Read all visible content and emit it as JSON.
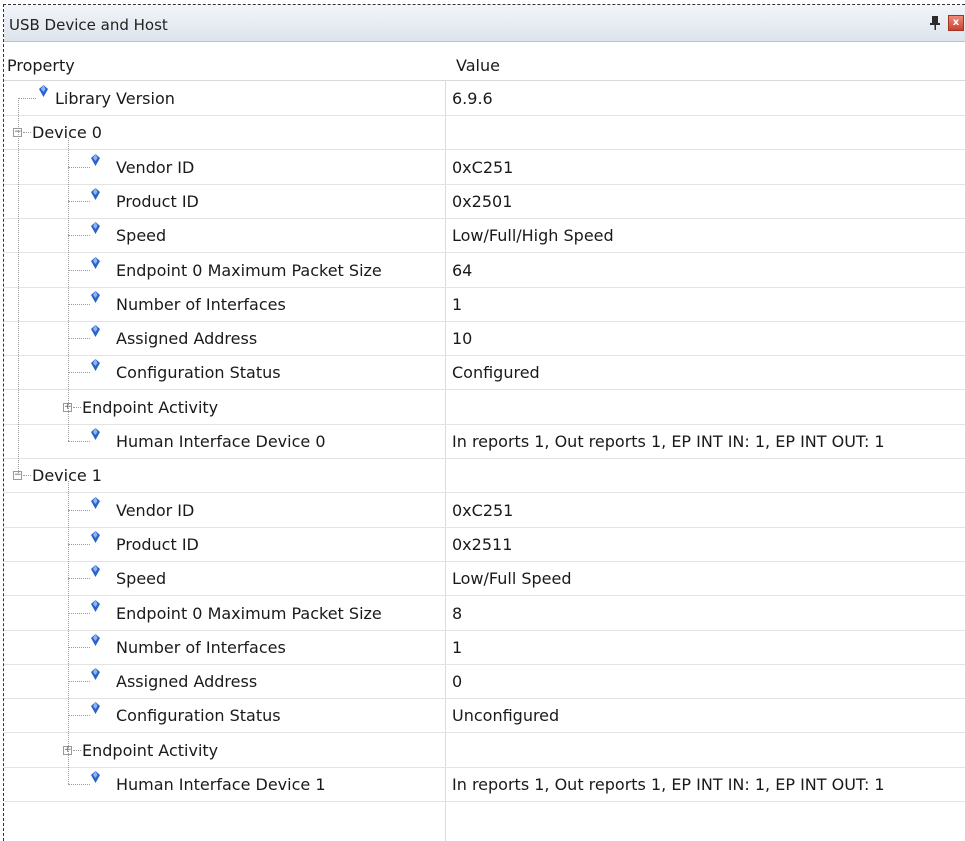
{
  "panel": {
    "title": "USB Device and Host",
    "close_label": "x"
  },
  "columns": {
    "property": "Property",
    "value": "Value"
  },
  "rows": [
    {
      "name": "Library Version",
      "value": "6.9.6"
    },
    {
      "name": "Device 0",
      "value": ""
    },
    {
      "name": "Vendor ID",
      "value": "0xC251"
    },
    {
      "name": "Product ID",
      "value": "0x2501"
    },
    {
      "name": "Speed",
      "value": "Low/Full/High Speed"
    },
    {
      "name": "Endpoint 0 Maximum Packet Size",
      "value": "64"
    },
    {
      "name": "Number of Interfaces",
      "value": "1"
    },
    {
      "name": "Assigned Address",
      "value": "10"
    },
    {
      "name": "Configuration Status",
      "value": "Configured"
    },
    {
      "name": "Endpoint Activity",
      "value": ""
    },
    {
      "name": "Human Interface Device 0",
      "value": "In reports 1, Out reports 1, EP INT IN: 1, EP INT OUT: 1"
    },
    {
      "name": "Device 1",
      "value": ""
    },
    {
      "name": "Vendor ID",
      "value": "0xC251"
    },
    {
      "name": "Product ID",
      "value": "0x2511"
    },
    {
      "name": "Speed",
      "value": "Low/Full Speed"
    },
    {
      "name": "Endpoint 0 Maximum Packet Size",
      "value": "8"
    },
    {
      "name": "Number of Interfaces",
      "value": "1"
    },
    {
      "name": "Assigned Address",
      "value": "0"
    },
    {
      "name": "Configuration Status",
      "value": "Unconfigured"
    },
    {
      "name": "Endpoint Activity",
      "value": ""
    },
    {
      "name": "Human Interface Device 1",
      "value": "In reports 1, Out reports 1, EP INT IN: 1, EP INT OUT: 1"
    }
  ],
  "icons": {
    "property": "property-gem-icon",
    "expand": "expand-plus-icon",
    "collapse": "collapse-minus-icon"
  },
  "colors": {
    "titlebar": "#dde4ec",
    "gem": "#2a62c9",
    "grid": "#e3e3e3"
  }
}
